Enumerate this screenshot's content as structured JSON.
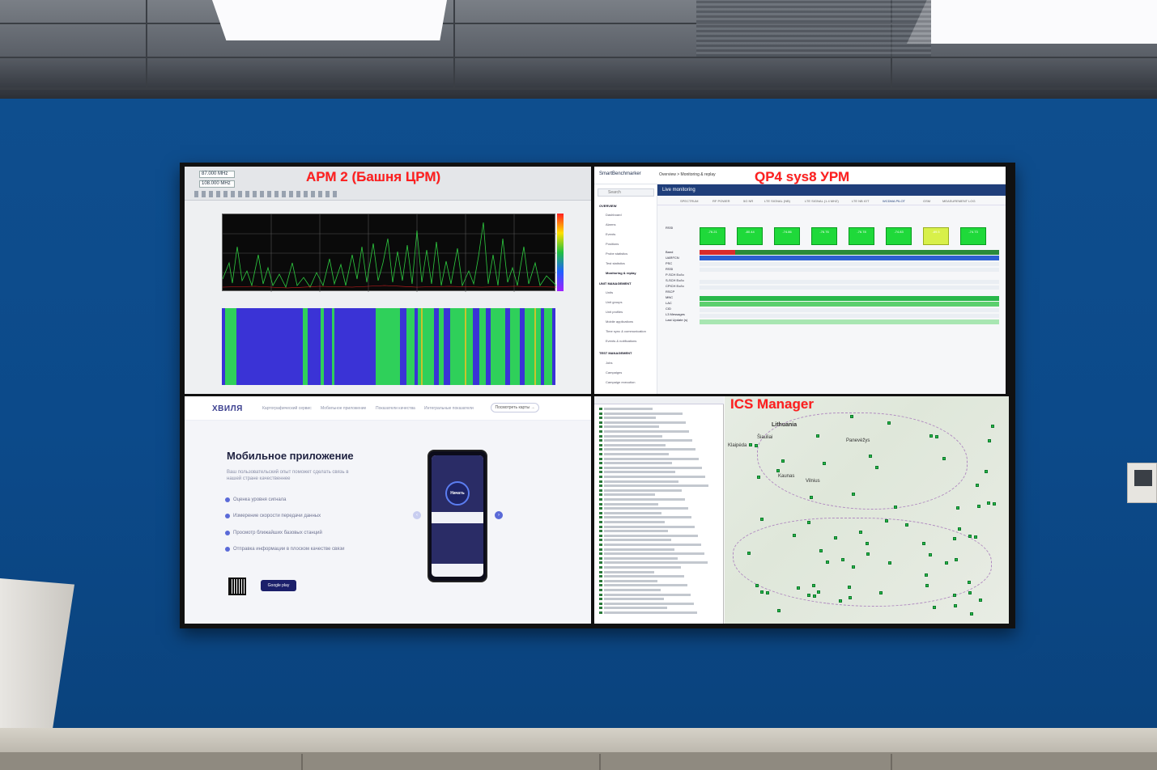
{
  "screens": {
    "top_left": {
      "overlay_title": "АРМ 2 (Башня ЦРМ)",
      "freq1": "87.000 MHz",
      "freq2": "108.000 MHz"
    },
    "top_right": {
      "overlay_title": "QP4 sys8 УРМ",
      "app_name": "SmartBenchmarker",
      "breadcrumb": "Overview > Monitoring & replay",
      "search_placeholder": "Search",
      "live_title": "Live monitoring",
      "tabs": [
        "SPECTRUM",
        "RF POWER",
        "5G NR",
        "LTE SIGNAL (NB)",
        "LTE SIGNAL (1.4 MHZ)",
        "LTE NB IOT",
        "WCDMA PILOT",
        "GSM",
        "MEASUREMENT LOG"
      ],
      "sidebar": {
        "overview": "OVERVIEW",
        "overview_items": [
          "Dashboard",
          "Alarms",
          "Events",
          "Positions",
          "Probe statistics",
          "Test statistics",
          "Monitoring & replay"
        ],
        "unit_management": "UNIT MANAGEMENT",
        "unit_items": [
          "Units",
          "Unit groups",
          "Unit profiles",
          "Mobile applications",
          "Time sync & communication",
          "Events & notifications"
        ],
        "test_management": "TEST MANAGEMENT",
        "test_items": [
          "Jobs",
          "Campaigns",
          "Campaign execution"
        ]
      },
      "metrics": [
        "RSSI",
        "Band",
        "UARFCN",
        "PSC",
        "RSSI",
        "P-SCH Ec/Io",
        "S-SCH Ec/Io",
        "CPICH Ec/Io",
        "RSCP",
        "MNC",
        "LAC",
        "CID",
        "L3 Messages",
        "Last Update (s)"
      ],
      "rssi_values": [
        "-76.21",
        "-80.44",
        "-74.86",
        "-76.76",
        "-76.78",
        "-74.83",
        "-89.5",
        "-74.73"
      ]
    },
    "bottom_left": {
      "logo": "ХВИЛЯ",
      "nav": [
        "Картографический сервис",
        "Мобильное приложение",
        "Показатели качества",
        "Интегральные показатели"
      ],
      "cta": "Посмотреть карты →",
      "heading": "Мобильное приложение",
      "subtitle": "Ваш пользовательский опыт поможет сделать связь в нашей стране качественнее",
      "features": [
        "Оценка уровня сигнала",
        "Измерение скорости передачи данных",
        "Просмотр ближайших базовых станций",
        "Отправка информации в плоском качестве связи"
      ],
      "store_badge": "Google play",
      "phone_button": "Начать"
    },
    "bottom_right": {
      "overlay_title": "ICS Manager",
      "map_labels": [
        "Lithuania",
        "Klaipėda",
        "Vilnius",
        "Kaunas",
        "Šiauliai",
        "Panevėžys"
      ]
    }
  }
}
